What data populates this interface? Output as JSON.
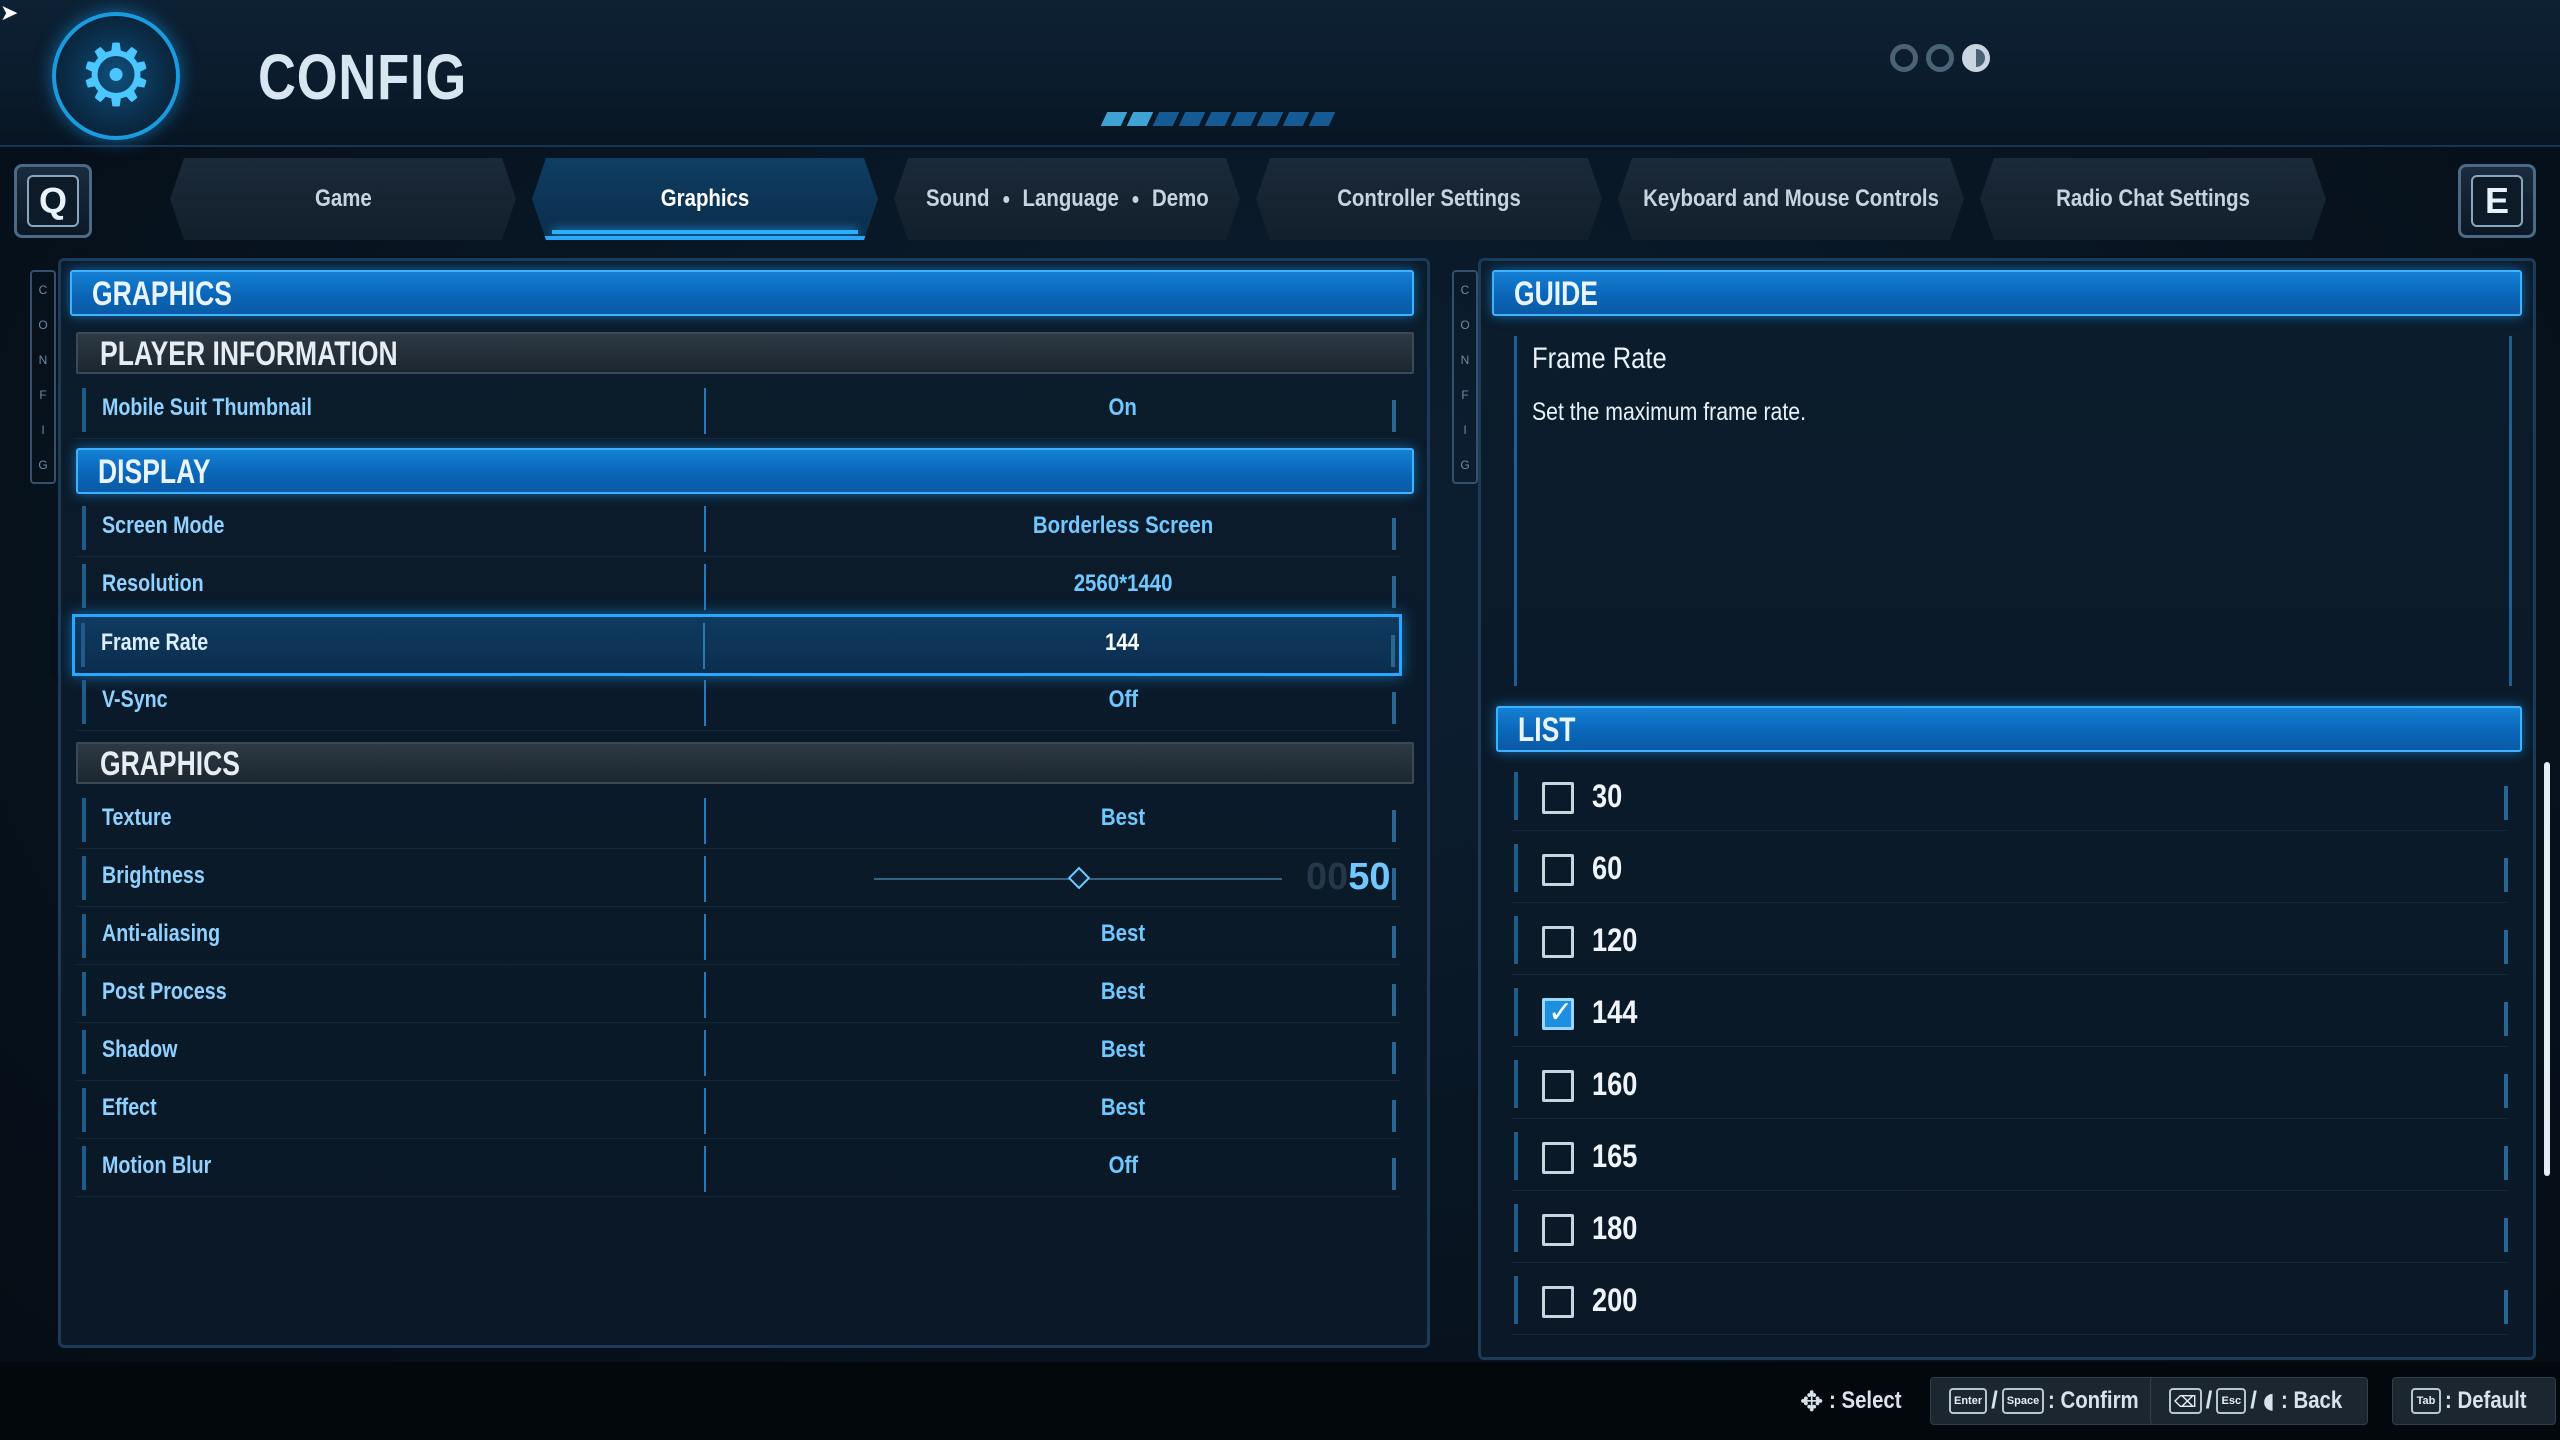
{
  "header": {
    "title": "CONFIG",
    "icon": "gear-icon"
  },
  "tabs": {
    "left_key": "Q",
    "right_key": "E",
    "items": [
      {
        "label": "Game"
      },
      {
        "label": "Graphics",
        "active": true
      },
      {
        "label": "Sound · Language · Demo",
        "parts": [
          "Sound",
          "Language",
          "Demo"
        ]
      },
      {
        "label": "Controller Settings"
      },
      {
        "label": "Keyboard and Mouse Controls"
      },
      {
        "label": "Radio Chat Settings"
      }
    ]
  },
  "left": {
    "section_title": "GRAPHICS",
    "player_info_title": "PLAYER INFORMATION",
    "display_title": "DISPLAY",
    "graphics_title": "GRAPHICS",
    "player_rows": [
      {
        "label": "Mobile Suit Thumbnail",
        "value": "On"
      }
    ],
    "display_rows": [
      {
        "label": "Screen Mode",
        "value": "Borderless Screen"
      },
      {
        "label": "Resolution",
        "value": "2560*1440"
      },
      {
        "label": "Frame Rate",
        "value": "144",
        "selected": true
      },
      {
        "label": "V-Sync",
        "value": "Off"
      }
    ],
    "graphics_rows": [
      {
        "label": "Texture",
        "value": "Best"
      },
      {
        "label": "Brightness",
        "value": "50",
        "ghost": "00",
        "slider": true
      },
      {
        "label": "Anti-aliasing",
        "value": "Best"
      },
      {
        "label": "Post Process",
        "value": "Best"
      },
      {
        "label": "Shadow",
        "value": "Best"
      },
      {
        "label": "Effect",
        "value": "Best"
      },
      {
        "label": "Motion Blur",
        "value": "Off"
      }
    ],
    "side_tab": "CONFIG"
  },
  "brightness": {
    "fraction": 0.5
  },
  "guide": {
    "section_title": "GUIDE",
    "title": "Frame Rate",
    "description": "Set the maximum frame rate."
  },
  "list": {
    "section_title": "LIST",
    "items": [
      {
        "value": "30",
        "checked": false
      },
      {
        "value": "60",
        "checked": false
      },
      {
        "value": "120",
        "checked": false
      },
      {
        "value": "144",
        "checked": true
      },
      {
        "value": "160",
        "checked": false
      },
      {
        "value": "165",
        "checked": false
      },
      {
        "value": "180",
        "checked": false
      },
      {
        "value": "200",
        "checked": false
      }
    ]
  },
  "footer": {
    "select": ": Select",
    "confirm": ": Confirm",
    "back": ": Back",
    "default": ": Default",
    "key_enter": "Enter",
    "key_space": "Space",
    "key_esc": "Esc",
    "key_tab": "Tab",
    "sep": "/"
  },
  "colors": {
    "accent": "#2aa6ff",
    "label": "#8fd1ff",
    "value": "#6fc8ff",
    "header_blue": "#0a66b8"
  }
}
